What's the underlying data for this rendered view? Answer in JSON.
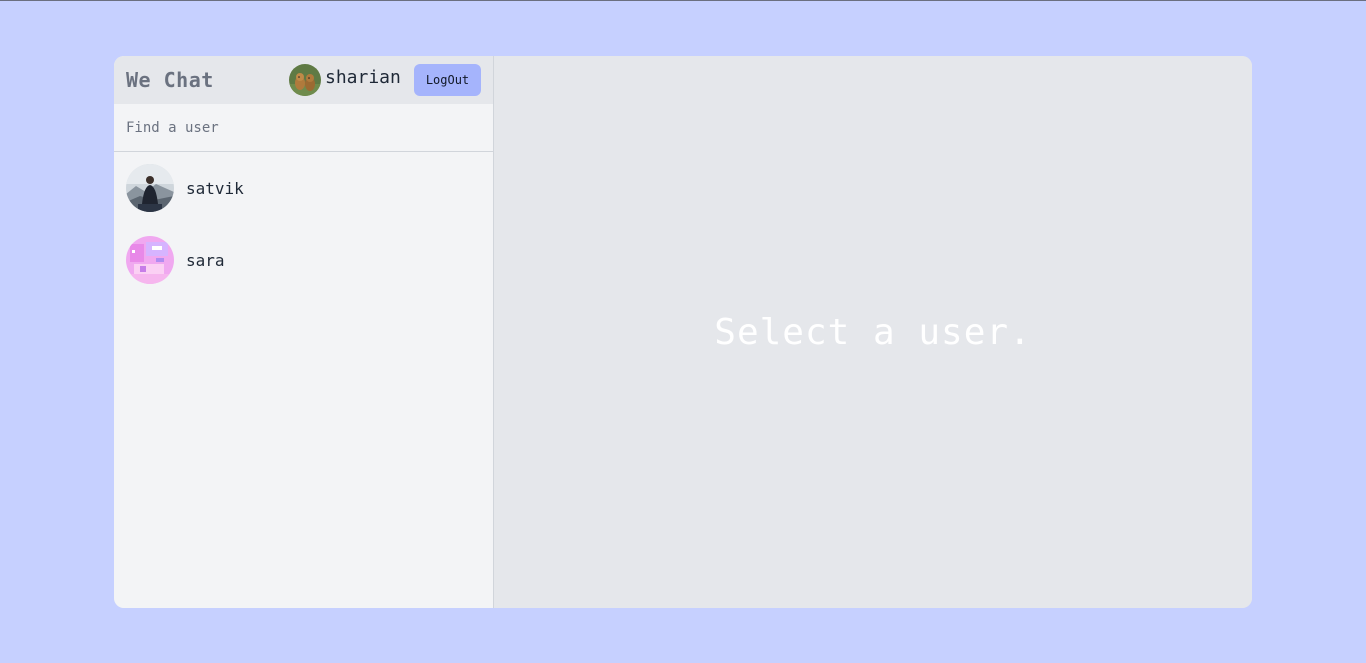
{
  "header": {
    "app_title": "We Chat",
    "current_user": {
      "name": "sharian",
      "avatar": "dogs-avatar"
    },
    "logout_label": "LogOut"
  },
  "search": {
    "placeholder": "Find a user",
    "value": ""
  },
  "users": [
    {
      "name": "satvik",
      "avatar": "mountain-person-avatar"
    },
    {
      "name": "sara",
      "avatar": "pink-abstract-avatar"
    }
  ],
  "main": {
    "placeholder": "Select a user."
  },
  "colors": {
    "page_background": "#c6d0ff",
    "sidebar_background": "#f3f4f6",
    "header_background": "#e5e7eb",
    "main_background": "#e5e7eb",
    "logout_button": "#a5b4fc",
    "placeholder_text": "#ffffff"
  }
}
